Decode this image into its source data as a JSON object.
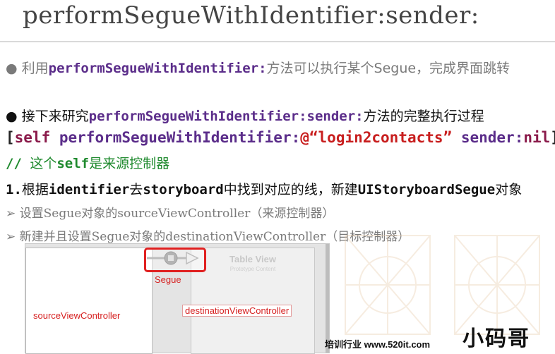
{
  "title": "performSegueWithIdentifier:sender:",
  "bullet1": {
    "bullet": "●",
    "prefix": "利用",
    "method": "performSegueWithIdentifier:",
    "suffix": "方法可以执行某个Segue，完成界面跳转"
  },
  "bullet2": {
    "bullet": "●",
    "prefix": "接下来研究",
    "method": "performSegueWithIdentifier:sender:",
    "suffix": "方法的完整执行过程"
  },
  "code": {
    "open": "[",
    "self": "self",
    "sel1": " performSegueWithIdentifier:",
    "str": "@“login2contacts”",
    "sel2": " sender:",
    "nil": "nil",
    "close": "];"
  },
  "comment": {
    "slashes": "// ",
    "text1": "这个",
    "self": "self",
    "text2": "是来源控制器"
  },
  "step1": {
    "num": "1.",
    "p1": "根据",
    "k1": "identifier",
    "p2": "去",
    "k2": "storyboard",
    "p3": "中找到对应的线，新建",
    "k3": "UIStoryboardSegue",
    "p4": "对象"
  },
  "sub1": {
    "arrow": "➢",
    "text": "设置Segue对象的sourceViewController（来源控制器）"
  },
  "sub2": {
    "arrow": "➢",
    "text": "新建并且设置Segue对象的destinationViewController（目标控制器）"
  },
  "diagram": {
    "source_label": "sourceViewController",
    "dest_label": "destinationViewController",
    "segue_label": "Segue",
    "table_view_title": "Table View",
    "table_view_sub": "Prototype Content"
  },
  "footer": {
    "text": "培训行业  www.520it.com",
    "logo": "小码哥"
  }
}
